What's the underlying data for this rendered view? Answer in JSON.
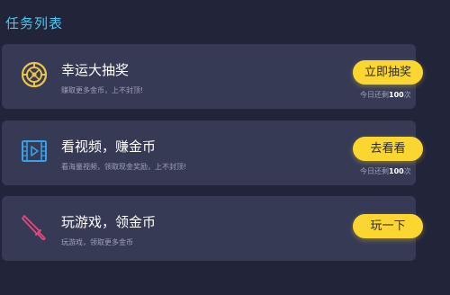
{
  "section": {
    "title": "任务列表"
  },
  "tasks": [
    {
      "title": "幸运大抽奖",
      "description": "赚取更多金币，上不封顶!",
      "button_label": "立即抽奖",
      "remaining_prefix": "今日还剩",
      "remaining_count": "100",
      "remaining_suffix": "次",
      "icon": "wheel-icon",
      "icon_color": "#e8c54a"
    },
    {
      "title": "看视频，赚金币",
      "description": "看海量视频，领取现金奖励，上不封顶!",
      "button_label": "去看看",
      "remaining_prefix": "今日还剩",
      "remaining_count": "100",
      "remaining_suffix": "次",
      "icon": "video-icon",
      "icon_color": "#3aa0e8"
    },
    {
      "title": "玩游戏，领金币",
      "description": "玩游戏，领取更多金币",
      "button_label": "玩一下",
      "icon": "knife-icon",
      "icon_color": "#e04a7a"
    }
  ],
  "colors": {
    "background": "#22243a",
    "card": "#363a55",
    "accent_title": "#45c8ee",
    "button": "#fbd630"
  }
}
